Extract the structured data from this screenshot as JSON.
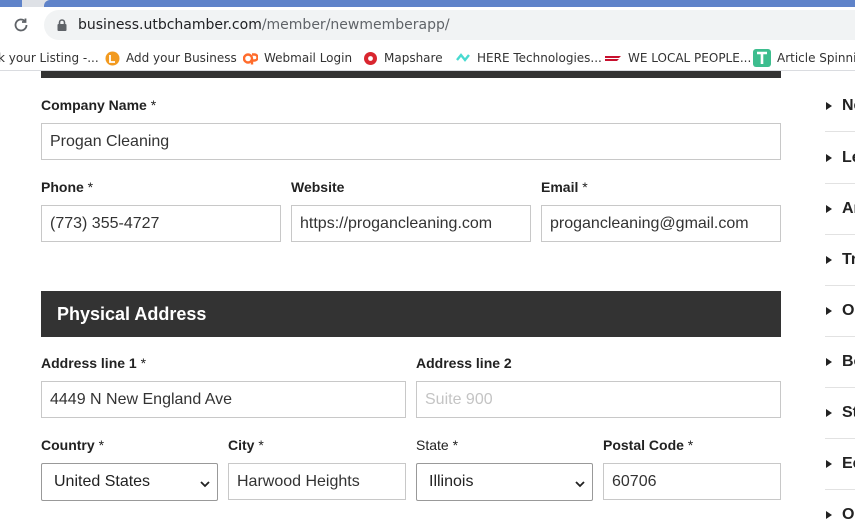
{
  "browser": {
    "url_host": "business.utbchamber.com",
    "url_path": "/member/newmemberapp/",
    "bookmarks": [
      {
        "label": "k your Listing -...",
        "icon": "none"
      },
      {
        "label": "Add your Business",
        "icon": "pin-icon"
      },
      {
        "label": "Webmail Login",
        "icon": "cpanel-icon"
      },
      {
        "label": "Mapshare",
        "icon": "mapshare-icon"
      },
      {
        "label": "HERE Technologies...",
        "icon": "here-icon"
      },
      {
        "label": "WE LOCAL PEOPLE...",
        "icon": "flag-icon"
      },
      {
        "label": "Article Spinning",
        "icon": "article-icon"
      }
    ]
  },
  "form": {
    "company_name": {
      "label": "Company Name",
      "required": "*",
      "value": "Progan Cleaning"
    },
    "phone": {
      "label": "Phone",
      "required": "*",
      "value": "(773) 355-4727"
    },
    "website": {
      "label": "Website",
      "value": "https://progancleaning.com"
    },
    "email": {
      "label": "Email",
      "required": "*",
      "value": "progancleaning@gmail.com"
    },
    "physical_address": {
      "heading": "Physical Address",
      "address1": {
        "label": "Address line 1",
        "required": "*",
        "value": "4449 N New England Ave"
      },
      "address2": {
        "label": "Address line 2",
        "placeholder": "Suite 900"
      },
      "country": {
        "label": "Country",
        "required": "*",
        "value": "United States"
      },
      "city": {
        "label": "City",
        "required": "*",
        "value": "Harwood Heights"
      },
      "state": {
        "label": "State",
        "required": "*",
        "value": "Illinois"
      },
      "postal_code": {
        "label": "Postal Code",
        "required": "*",
        "value": "60706"
      }
    }
  },
  "sidebar": {
    "items": [
      "Ne",
      "Le",
      "Ar",
      "Tr",
      "Ou",
      "Bo",
      "St",
      "Ec",
      "Ou"
    ]
  },
  "colors": {
    "dark_header": "#333333",
    "tab_accent": "#5f83c9"
  }
}
